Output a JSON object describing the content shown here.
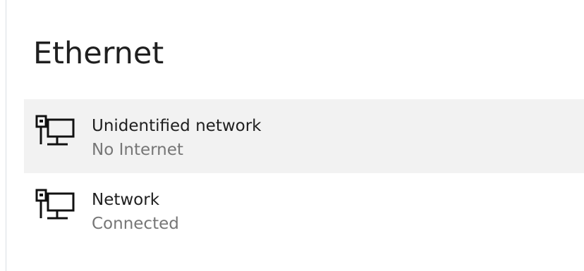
{
  "page": {
    "title": "Ethernet"
  },
  "networks": [
    {
      "name": "Unidentified network",
      "status": "No Internet",
      "icon": "ethernet-network-icon",
      "selected": true
    },
    {
      "name": "Network",
      "status": "Connected",
      "icon": "ethernet-network-icon",
      "selected": false
    }
  ],
  "colors": {
    "background": "#ffffff",
    "selected_background": "#f2f2f2",
    "primary_text": "#202020",
    "secondary_text": "#767676"
  }
}
